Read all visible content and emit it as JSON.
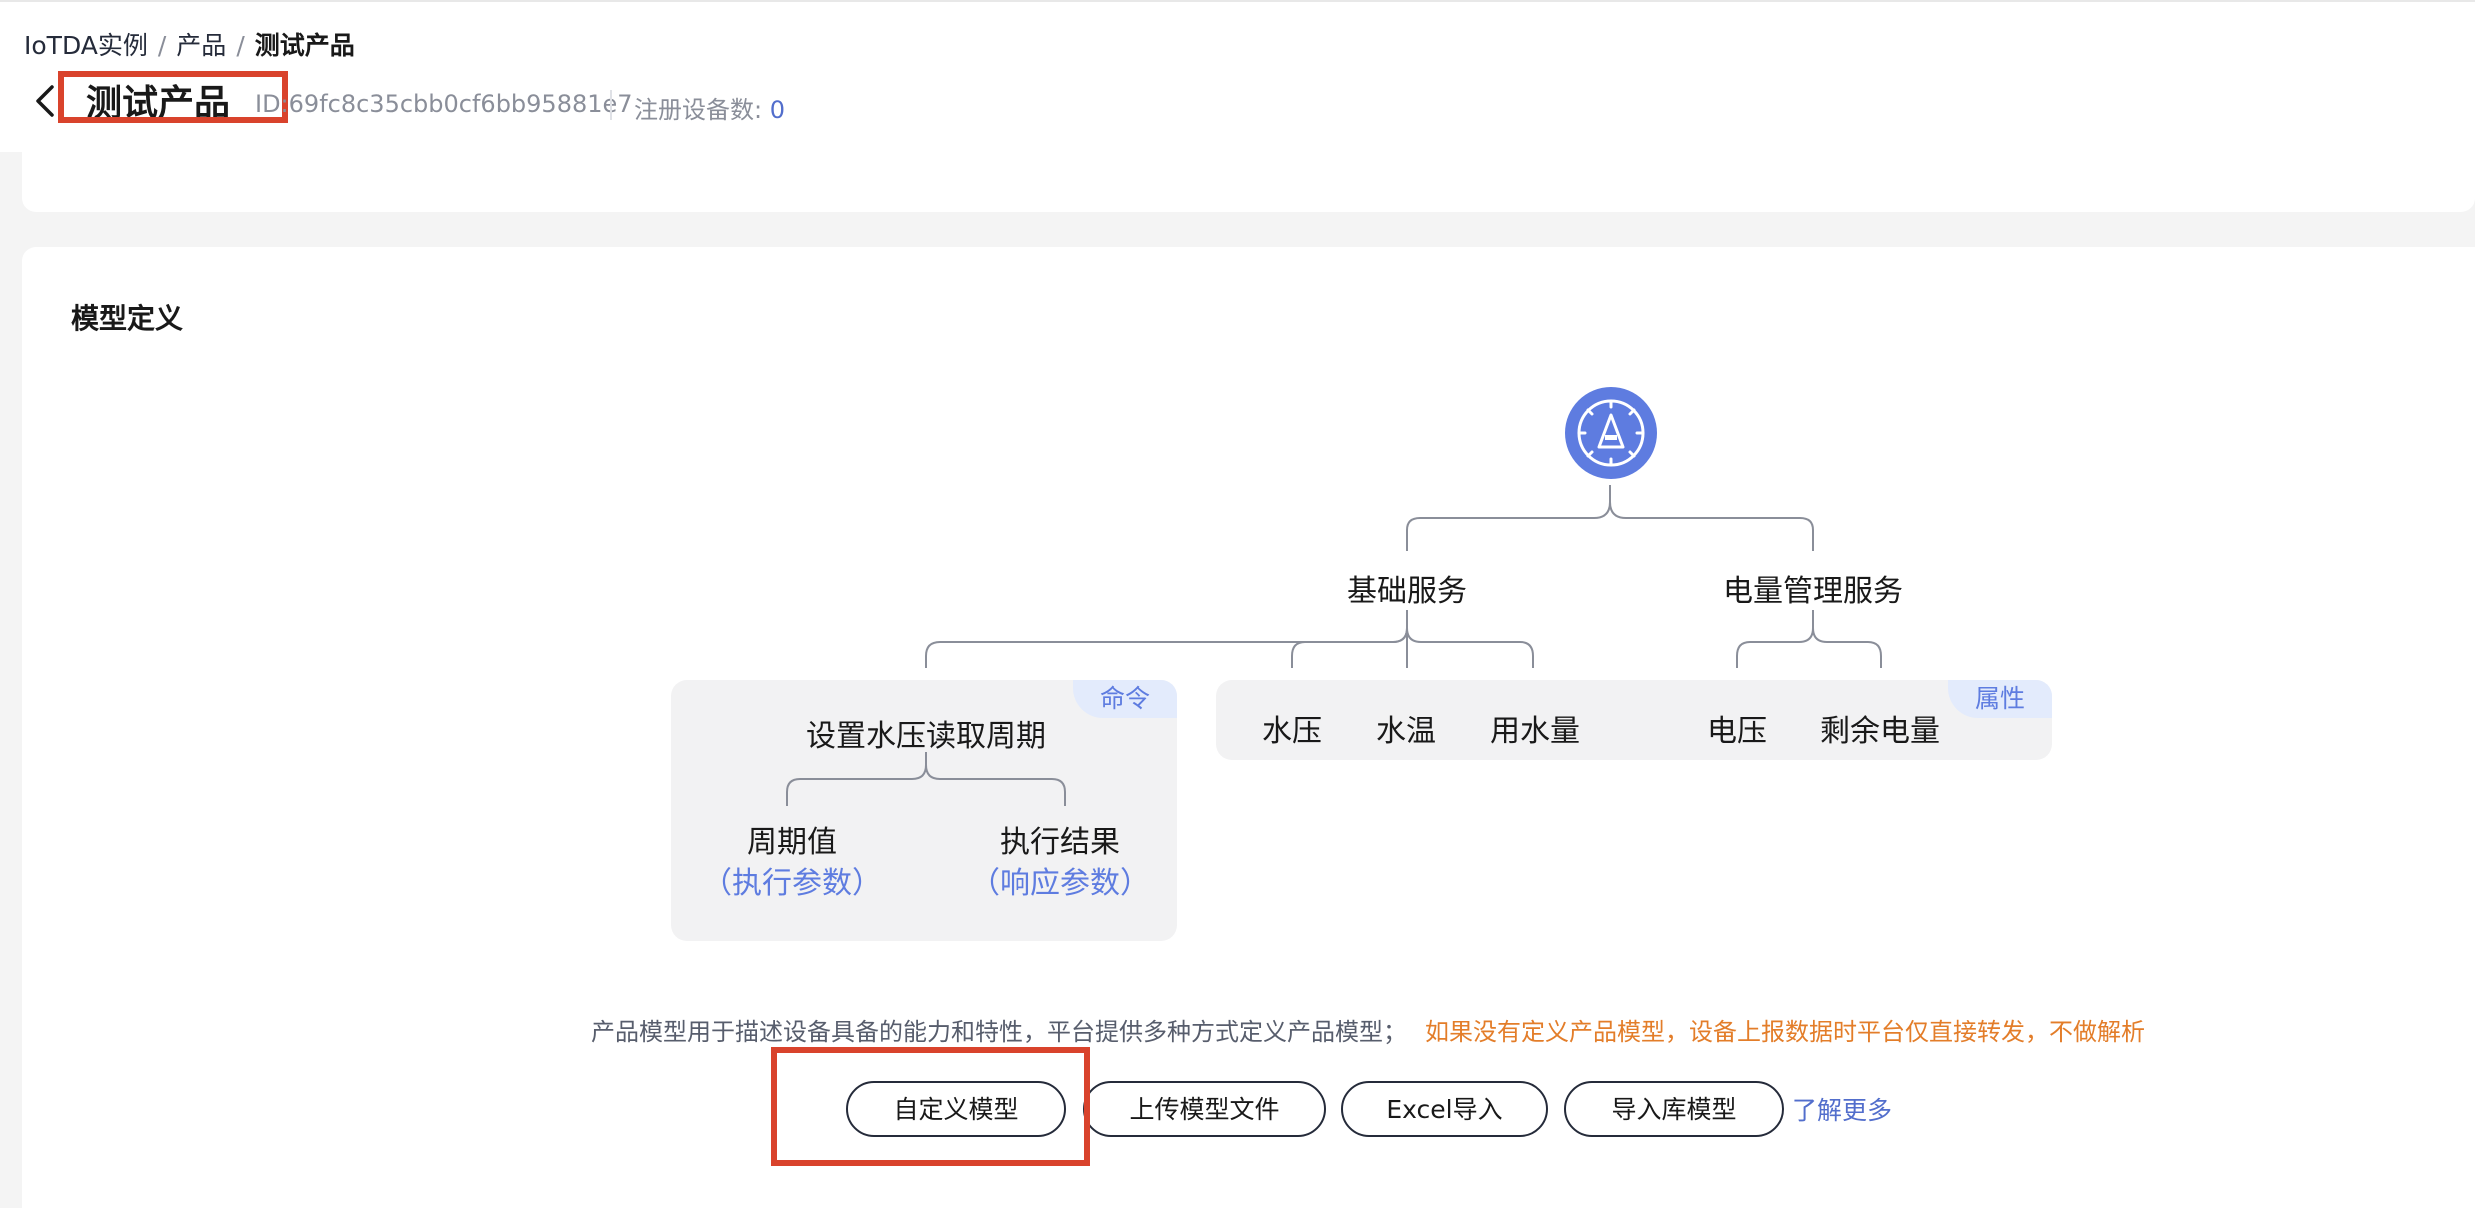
{
  "breadcrumb": [
    "IoTDA实例",
    "产品",
    "测试产品"
  ],
  "header": {
    "title": "测试产品",
    "id_label": "ID:",
    "id_value": "69fc8c35cbb0cf6bb95881e7",
    "reg_label": "注册设备数:",
    "reg_count": "0"
  },
  "section": {
    "title": "模型定义"
  },
  "diagram": {
    "services": [
      "基础服务",
      "电量管理服务"
    ],
    "command_tag": "命令",
    "property_tag": "属性",
    "command_name": "设置水压读取周期",
    "command_params": [
      {
        "name": "周期值",
        "type": "（执行参数）"
      },
      {
        "name": "执行结果",
        "type": "（响应参数）"
      }
    ],
    "properties_basic": [
      "水压",
      "水温",
      "用水量"
    ],
    "properties_power": [
      "电压",
      "剩余电量"
    ]
  },
  "description": {
    "text": "产品模型用于描述设备具备的能力和特性，平台提供多种方式定义产品模型；",
    "warning": "如果没有定义产品模型，设备上报数据时平台仅直接转发，不做解析"
  },
  "buttons": {
    "custom": "自定义模型",
    "upload": "上传模型文件",
    "excel": "Excel导入",
    "library": "导入库模型",
    "learn_more": "了解更多"
  },
  "colors": {
    "accent": "#5e7ce0",
    "highlight": "#d9432c",
    "warning": "#e37d29"
  }
}
